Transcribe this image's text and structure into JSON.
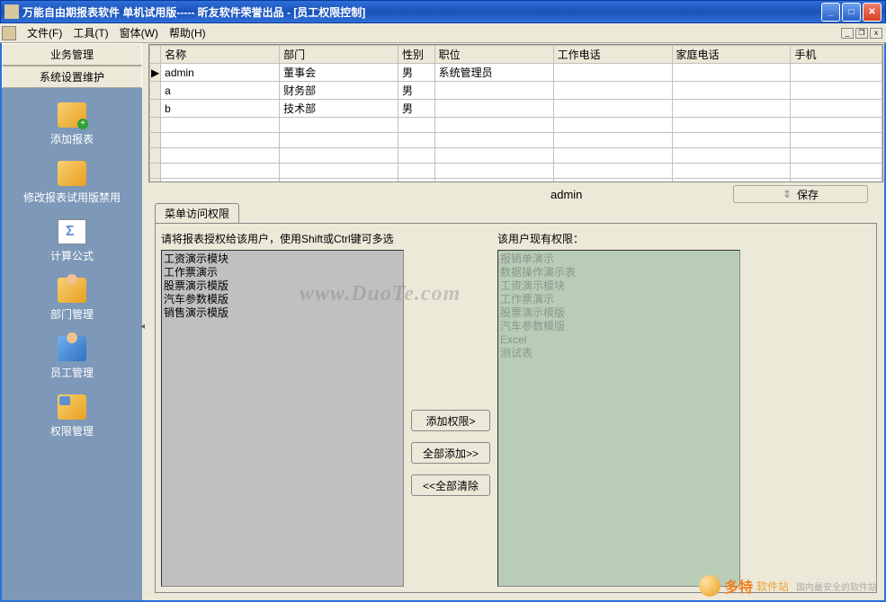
{
  "window": {
    "title": "万能自由期报表软件    单机试用版----- 昕友软件荣誉出品   -  [员工权限控制]"
  },
  "menu": {
    "file": "文件(F)",
    "tools": "工具(T)",
    "window": "窗体(W)",
    "help": "帮助(H)"
  },
  "sidebar": {
    "header1": "业务管理",
    "header2": "系统设置维护",
    "items": [
      {
        "label": "添加报表"
      },
      {
        "label": "修改报表试用版禁用"
      },
      {
        "label": "计算公式"
      },
      {
        "label": "部门管理"
      },
      {
        "label": "员工管理"
      },
      {
        "label": "权限管理"
      }
    ]
  },
  "grid": {
    "cols": [
      "名称",
      "部门",
      "性别",
      "职位",
      "工作电话",
      "家庭电话",
      "手机"
    ],
    "rows": [
      {
        "marker": "▶",
        "name": "admin",
        "dept": "董事会",
        "sex": "男",
        "pos": "系统管理员",
        "wphone": "",
        "hphone": "",
        "mobile": ""
      },
      {
        "marker": "",
        "name": "a",
        "dept": "财务部",
        "sex": "男",
        "pos": "",
        "wphone": "",
        "hphone": "",
        "mobile": ""
      },
      {
        "marker": "",
        "name": "b",
        "dept": "技术部",
        "sex": "男",
        "pos": "",
        "wphone": "",
        "hphone": "",
        "mobile": ""
      }
    ]
  },
  "mid": {
    "user": "admin",
    "save": "保存",
    "save_icon": "⇕"
  },
  "tab": {
    "label": "菜单访问权限"
  },
  "perm": {
    "left_label": "请将报表授权给该用户，使用Shift或Ctrl键可多选",
    "right_label": "该用户现有权限：",
    "left_items": [
      "工资演示模块",
      "工作票演示",
      "股票演示模版",
      "汽车参数模版",
      "销售演示模版"
    ],
    "right_items": [
      "报销单演示",
      "数据操作演示表",
      "工资演示模块",
      "工作票演示",
      "股票演示模版",
      "汽车参数模版",
      "Excel",
      "测试表"
    ],
    "btn_add": "添加权限>",
    "btn_addall": "全部添加>>",
    "btn_clear": "<<全部清除"
  },
  "watermark": "www.DuoTe.com",
  "footer": {
    "big": "多特",
    "small": "软件站",
    "sub": "国内最安全的软件站"
  }
}
